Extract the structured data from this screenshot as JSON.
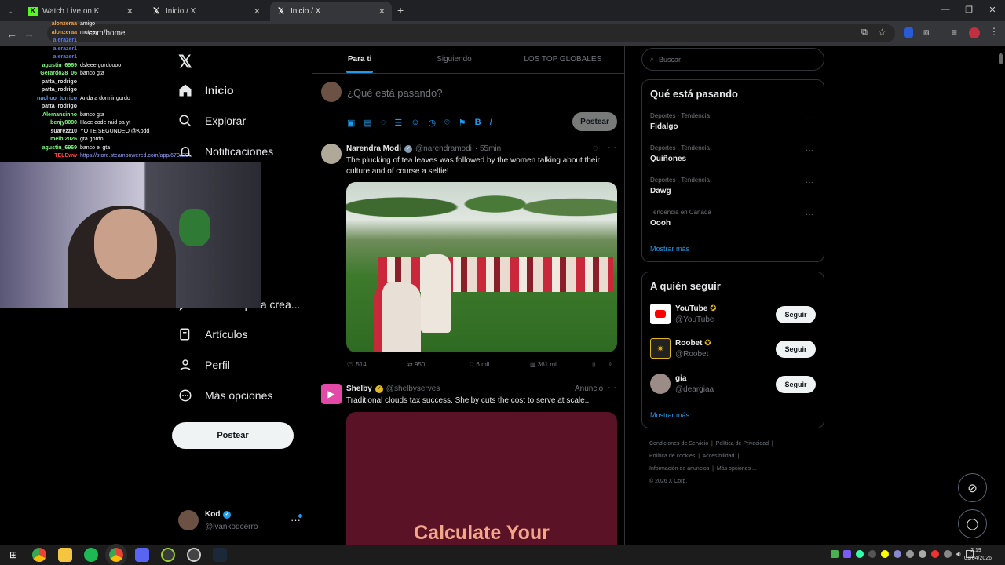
{
  "browser": {
    "tabs": [
      {
        "label": "Watch Live on K",
        "active": false
      },
      {
        "label": "Inicio / X",
        "active": false
      },
      {
        "label": "Inicio / X",
        "active": true
      }
    ],
    "url": ".com/home"
  },
  "nav": {
    "items": [
      "Inicio",
      "Explorar",
      "Notificaciones",
      "Estudio para crea...",
      "Artículos",
      "Perfil",
      "Más opciones"
    ],
    "post_label": "Postear",
    "user_name": "Kod",
    "user_handle": "@ivankodcerro"
  },
  "feed": {
    "tabs": [
      "Para ti",
      "Siguiendo",
      "LOS TOP GLOBALES"
    ],
    "composer_placeholder": "¿Qué está pasando?",
    "composer_post": "Postear",
    "tweets": [
      {
        "name": "Narendra Modi",
        "handle": "@narendramodi",
        "time": "· 55min",
        "text": "The plucking of tea leaves was followed by the women talking about their culture and of course a selfie!",
        "replies": "514",
        "retweets": "950",
        "likes": "6 mil",
        "views": "361 mil"
      },
      {
        "name": "Shelby",
        "handle": "@shelbyserves",
        "tag": "Anuncio",
        "text": "Traditional clouds tax success. Shelby cuts the cost to serve at scale..",
        "ad_headline": "Calculate Your"
      }
    ]
  },
  "search": {
    "placeholder": "Buscar"
  },
  "trends": {
    "title": "Qué está pasando",
    "items": [
      {
        "category": "Deportes · Tendencia",
        "name": "Fidalgo"
      },
      {
        "category": "Deportes · Tendencia",
        "name": "Quiñones"
      },
      {
        "category": "Deportes · Tendencia",
        "name": "Dawg"
      },
      {
        "category": "Tendencia en Canadá",
        "name": "Oooh"
      }
    ],
    "more": "Mostrar más"
  },
  "who_to_follow": {
    "title": "A quién seguir",
    "items": [
      {
        "name": "YouTube",
        "handle": "@YouTube",
        "button": "Seguir"
      },
      {
        "name": "Roobet",
        "handle": "@Roobet",
        "button": "Seguir"
      },
      {
        "name": "gia",
        "handle": "@deargiaa",
        "button": "Seguir"
      }
    ],
    "more": "Mostrar más"
  },
  "footer": {
    "links": [
      "Condiciones de Servicio",
      "Política de Privacidad",
      "Política de cookies",
      "Accesibilidad",
      "Información de anuncios",
      "Más opciones ...",
      "© 2026 X Corp."
    ]
  },
  "stream_chat": [
    {
      "user": "alonzeraa",
      "msg": "amigo",
      "color": "#f0a040"
    },
    {
      "user": "alonzeraa",
      "msg": "mutea",
      "color": "#f0a040"
    },
    {
      "user": "alerazer1",
      "msg": "",
      "color": "#5a7af0"
    },
    {
      "user": "alerazer1",
      "msg": "",
      "color": "#5a7af0"
    },
    {
      "user": "alerazer1",
      "msg": "",
      "color": "#5a7af0"
    },
    {
      "user": "agustin_6969",
      "msg": "dsleee gordoooo",
      "color": "#7cfc7c"
    },
    {
      "user": "Gerardo28_06",
      "msg": "banco gta",
      "color": "#7cfc7c"
    },
    {
      "user": "patta_rodrigo",
      "msg": "",
      "color": "#e0e0e0"
    },
    {
      "user": "patta_rodrigo",
      "msg": "",
      "color": "#e0e0e0"
    },
    {
      "user": "nachoo_torrico",
      "msg": "Anda a dormir gordo",
      "color": "#60a0f0"
    },
    {
      "user": "patta_rodrigo",
      "msg": "",
      "color": "#e0e0e0"
    },
    {
      "user": "Alemansinho",
      "msg": "banco gta",
      "color": "#7cfc7c"
    },
    {
      "user": "benjy8080",
      "msg": "Hace code raid pa yt",
      "color": "#7cfc7c"
    },
    {
      "user": "suarezz10",
      "msg": "YO TE SEGUNDEO @Kodd",
      "color": "#e0e0e0"
    },
    {
      "user": "meibi2026",
      "msg": "gta gordo",
      "color": "#7cfc7c"
    },
    {
      "user": "agustin_6969",
      "msg": "banco el gta",
      "color": "#7cfc7c"
    },
    {
      "user": "TELEww",
      "msg": "https://store.steampowered.com/app/670/SCU",
      "color": "#ff4040"
    }
  ],
  "clock": {
    "time": "2:19",
    "date": "01/04/2026"
  }
}
